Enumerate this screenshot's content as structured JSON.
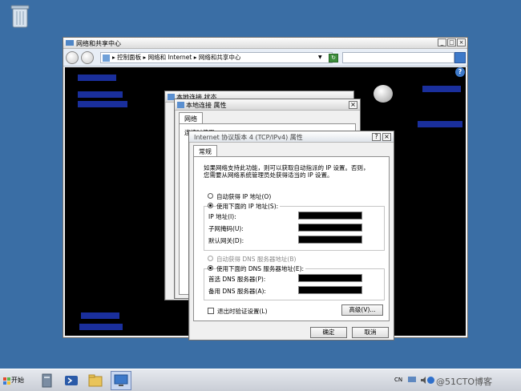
{
  "colors": {
    "desktop": "#3a6ea5",
    "link_bg": "#1a2f9c",
    "dark_content": "#000000"
  },
  "icons": {
    "desktop": "recycle-bin-icon",
    "start": "windows-logo-icon",
    "taskbar": [
      "server-manager-icon",
      "powershell-icon",
      "folder-icon",
      "network-icon"
    ],
    "tray": [
      "network-tray-icon",
      "volume-icon",
      "watermark-logo-icon"
    ]
  },
  "explorer": {
    "title": "网络和共享中心",
    "breadcrumb": "▸ 控制面板 ▸ 网络和 Internet ▸ 网络和共享中心",
    "caption": {
      "minimize": "_",
      "restore": "□",
      "close": "×"
    },
    "help": "?"
  },
  "status_dialog": {
    "title": "本地连接 状态"
  },
  "properties_dialog": {
    "title": "本地连接 属性",
    "tab_network": "网络",
    "connect_label": "连接时使用:"
  },
  "ipv4_dialog": {
    "title": "Internet 协议版本 4 (TCP/IPv4) 属性",
    "help_btn": "?",
    "close_btn": "×",
    "tab_general": "常规",
    "desc_line1": "如果网络支持此功能，则可以获取自动指派的 IP 设置。否则，",
    "desc_line2": "您需要从网络系统管理员处获得适当的 IP 设置。",
    "auto_ip": "自动获得 IP 地址(O)",
    "manual_ip": "使用下面的 IP 地址(S):",
    "ip_addr": "IP 地址(I):",
    "subnet": "子网掩码(U):",
    "gateway": "默认网关(D):",
    "auto_dns": "自动获得 DNS 服务器地址(B)",
    "manual_dns": "使用下面的 DNS 服务器地址(E):",
    "pref_dns": "首选 DNS 服务器(P):",
    "alt_dns": "备用 DNS 服务器(A):",
    "validate": "退出时验证设置(L)",
    "advanced": "高级(V)...",
    "ok": "确定",
    "cancel": "取消"
  },
  "taskbar": {
    "start": "开始",
    "lang": "CN",
    "watermark": "@51CTO博客"
  }
}
